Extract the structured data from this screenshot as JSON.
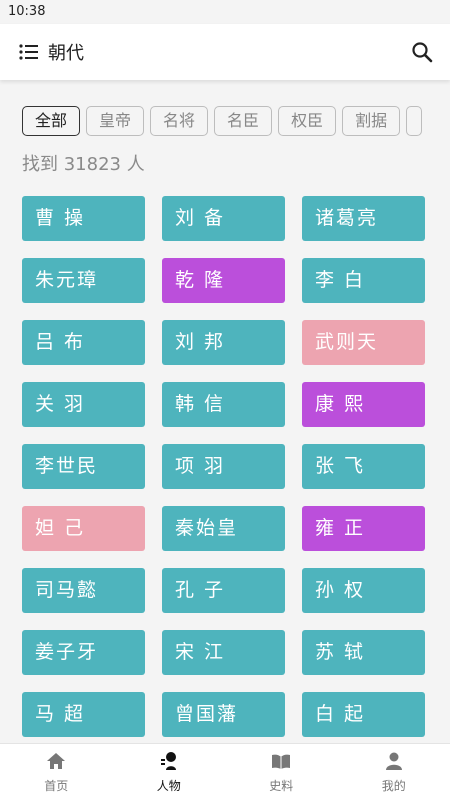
{
  "status_bar": {
    "time": "10:38"
  },
  "app_bar": {
    "title": "朝代",
    "menu_icon": "menu-icon",
    "search_icon": "search-icon"
  },
  "filters": [
    {
      "label": "全部",
      "active": true
    },
    {
      "label": "皇帝",
      "active": false
    },
    {
      "label": "名将",
      "active": false
    },
    {
      "label": "名臣",
      "active": false
    },
    {
      "label": "权臣",
      "active": false
    },
    {
      "label": "割据",
      "active": false
    },
    {
      "label": "",
      "active": false
    }
  ],
  "result_count_text": "找到 31823 人",
  "colors": {
    "teal": "#4eb4bd",
    "purple": "#bb4fdb",
    "pink": "#eda4b0"
  },
  "people": [
    {
      "name": "曹 操",
      "color": "teal"
    },
    {
      "name": "刘 备",
      "color": "teal"
    },
    {
      "name": "诸葛亮",
      "color": "teal"
    },
    {
      "name": "朱元璋",
      "color": "teal"
    },
    {
      "name": "乾 隆",
      "color": "purple"
    },
    {
      "name": "李 白",
      "color": "teal"
    },
    {
      "name": "吕 布",
      "color": "teal"
    },
    {
      "name": "刘 邦",
      "color": "teal"
    },
    {
      "name": "武则天",
      "color": "pink"
    },
    {
      "name": "关 羽",
      "color": "teal"
    },
    {
      "name": "韩 信",
      "color": "teal"
    },
    {
      "name": "康 熙",
      "color": "purple"
    },
    {
      "name": "李世民",
      "color": "teal"
    },
    {
      "name": "项 羽",
      "color": "teal"
    },
    {
      "name": "张 飞",
      "color": "teal"
    },
    {
      "name": "妲 己",
      "color": "pink"
    },
    {
      "name": "秦始皇",
      "color": "teal"
    },
    {
      "name": "雍 正",
      "color": "purple"
    },
    {
      "name": "司马懿",
      "color": "teal"
    },
    {
      "name": "孔 子",
      "color": "teal"
    },
    {
      "name": "孙 权",
      "color": "teal"
    },
    {
      "name": "姜子牙",
      "color": "teal"
    },
    {
      "name": "宋 江",
      "color": "teal"
    },
    {
      "name": "苏 轼",
      "color": "teal"
    },
    {
      "name": "马 超",
      "color": "teal"
    },
    {
      "name": "曾国藩",
      "color": "teal"
    },
    {
      "name": "白 起",
      "color": "teal"
    }
  ],
  "bottom_nav": [
    {
      "label": "首页",
      "icon": "home-icon",
      "active": false
    },
    {
      "label": "人物",
      "icon": "person-icon",
      "active": true
    },
    {
      "label": "史料",
      "icon": "book-icon",
      "active": false
    },
    {
      "label": "我的",
      "icon": "user-icon",
      "active": false
    }
  ]
}
